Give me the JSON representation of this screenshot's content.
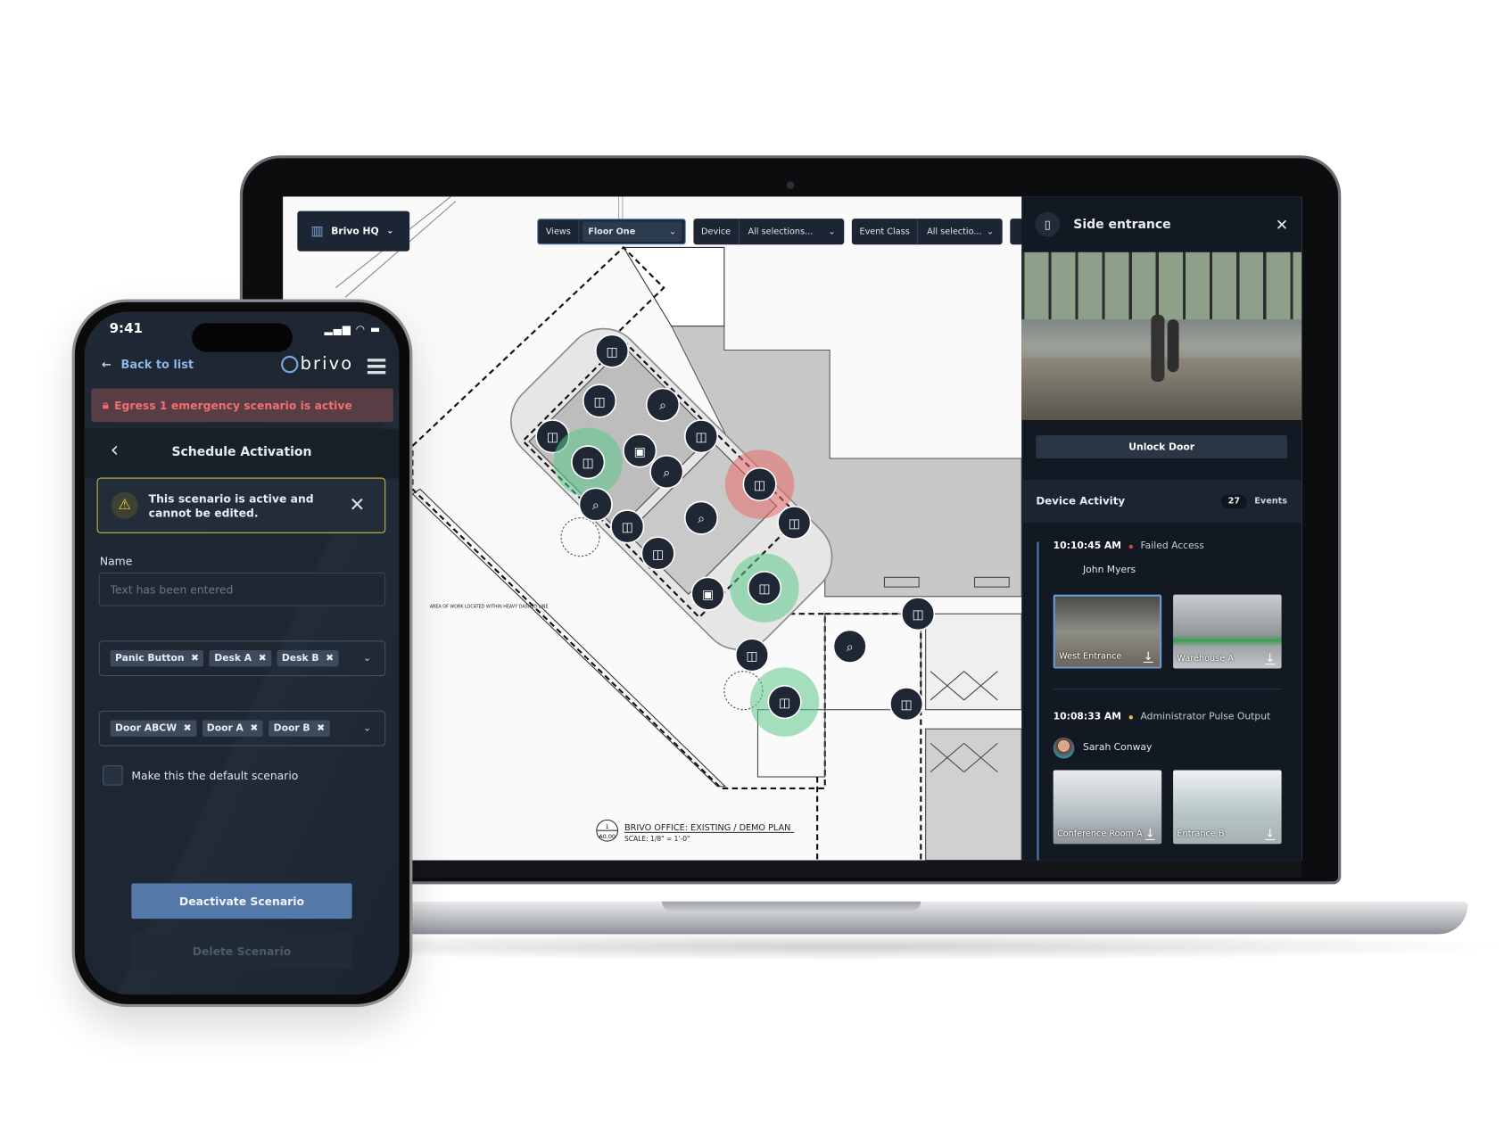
{
  "laptop": {
    "location_selector": {
      "label": "Brivo HQ",
      "icon": "building-icon"
    },
    "filters": [
      {
        "label": "Views",
        "value": "Floor One"
      },
      {
        "label": "Device",
        "value": "All selections..."
      },
      {
        "label": "Event Class",
        "value": "All selectio..."
      }
    ],
    "floor_plan": {
      "title": "BRIVO OFFICE:  EXISTING / DEMO PLAN",
      "scale": "SCALE: 1/8\"  =  1'-0\"",
      "detail_number": "1",
      "sheet": "A0.00",
      "note": "AREA OF WORK LOCATED WITHIN HEAVY DASHED LINE"
    },
    "side_panel": {
      "title": "Side entrance",
      "icon": "door-icon",
      "unlock_label": "Unlock Door",
      "activity_title": "Device Activity",
      "event_count": "27",
      "events_label": "Events",
      "events": [
        {
          "time": "10:10:45 AM",
          "type": "Failed Access",
          "status_color": "#e0483e",
          "user": "John Myers",
          "clips": [
            {
              "label": "West Entrance",
              "selected": true
            },
            {
              "label": "Warehouse A",
              "selected": false
            }
          ]
        },
        {
          "time": "10:08:33 AM",
          "type": "Administrator Pulse Output",
          "status_color": "#e8c640",
          "user": "Sarah Conway",
          "clips": [
            {
              "label": "Conference Room A",
              "selected": false
            },
            {
              "label": "Entrance B",
              "selected": false
            }
          ]
        }
      ]
    }
  },
  "phone": {
    "status_time": "9:41",
    "back_label": "Back to list",
    "brand": "brivo",
    "emergency_banner": "Egress 1 emergency scenario is active",
    "page_title": "Schedule Activation",
    "warning": "This scenario is active and cannot be edited.",
    "name_label": "Name",
    "name_placeholder": "Text has been entered",
    "devices_tags": [
      "Panic Button",
      "Desk A",
      "Desk B"
    ],
    "doors_tags": [
      "Door ABCW",
      "Door A",
      "Door B"
    ],
    "default_checkbox_label": "Make this the default scenario",
    "default_checked": false,
    "deactivate_label": "Deactivate Scenario",
    "delete_label": "Delete Scenario"
  },
  "colors": {
    "accent": "#5478a8",
    "alert": "#f07070",
    "warning": "#c9b94a",
    "ok_halo": "#5cc98a",
    "alarm_halo": "#e86a6a"
  }
}
